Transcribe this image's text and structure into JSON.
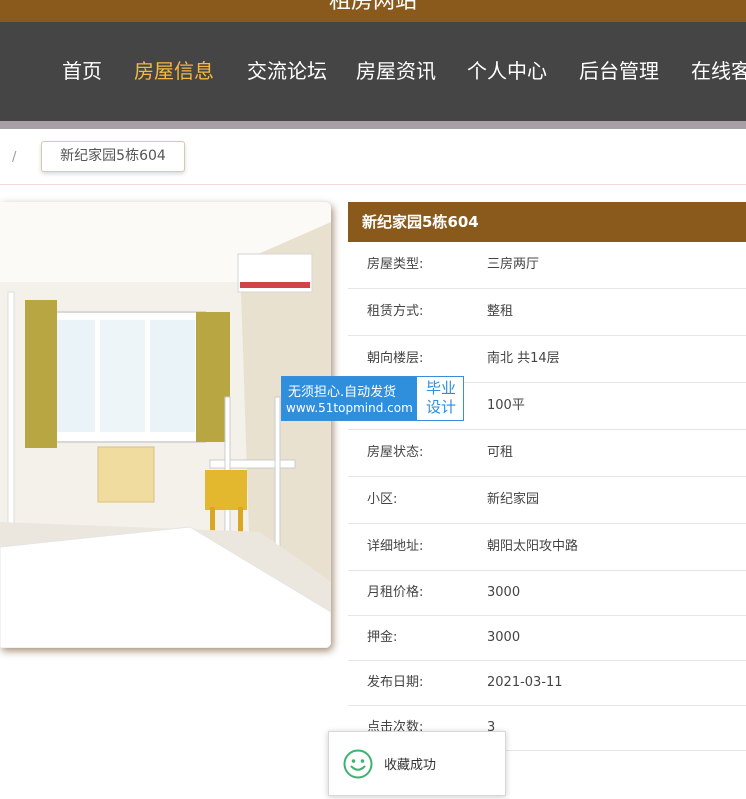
{
  "header": {
    "site_title": "租房网站"
  },
  "nav": {
    "items": [
      {
        "label": "首页"
      },
      {
        "label": "房屋信息",
        "active": true
      },
      {
        "label": "交流论坛"
      },
      {
        "label": "房屋资讯"
      },
      {
        "label": "个人中心"
      },
      {
        "label": "后台管理"
      },
      {
        "label": "在线客"
      }
    ],
    "active_color": "#f5b840"
  },
  "breadcrumb": {
    "separator": "/",
    "current": "新纪家园5栋604"
  },
  "detail": {
    "title": "新纪家园5栋604",
    "rows": [
      {
        "label": "房屋类型:",
        "value": "三房两厅"
      },
      {
        "label": "租赁方式:",
        "value": "整租"
      },
      {
        "label": "朝向楼层:",
        "value": "南北 共14层"
      },
      {
        "label": "",
        "value": "100平"
      },
      {
        "label": "房屋状态:",
        "value": "可租"
      },
      {
        "label": "小区:",
        "value": "新纪家园"
      },
      {
        "label": "详细地址:",
        "value": "朝阳太阳攻中路"
      },
      {
        "label": "月租价格:",
        "value": "3000"
      },
      {
        "label": "押金:",
        "value": "3000"
      },
      {
        "label": "发布日期:",
        "value": "2021-03-11"
      },
      {
        "label": "点击次数:",
        "value": "3"
      }
    ]
  },
  "watermark": {
    "line1": "无须担心.自动发货",
    "line2": "www.51topmind.com",
    "side": "毕业设计"
  },
  "toast": {
    "message": "收藏成功",
    "icon": "smile-icon"
  },
  "colors": {
    "brand": "#8a5a1c",
    "nav_bg": "#454545",
    "watermark_blue": "#2f8fdc"
  }
}
